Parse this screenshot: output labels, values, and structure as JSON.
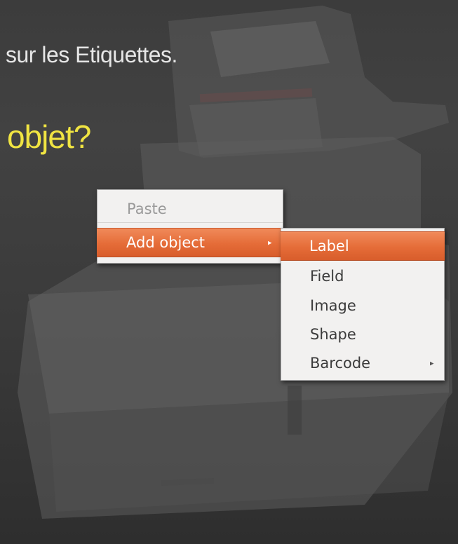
{
  "background": {
    "headline_line1": "sur les Etiquettes.",
    "headline_line2": "objet?",
    "headline_line2_color": "#f0e442"
  },
  "context_menu": {
    "items": [
      {
        "label": "Paste",
        "enabled": false
      },
      {
        "label": "Add object",
        "enabled": true,
        "highlighted": true,
        "has_submenu": true,
        "submenu_icon": "chevron-right-icon",
        "glyph": "▸"
      }
    ]
  },
  "submenu": {
    "items": [
      {
        "label": "Label",
        "highlighted": true
      },
      {
        "label": "Field"
      },
      {
        "label": "Image"
      },
      {
        "label": "Shape"
      },
      {
        "label": "Barcode",
        "has_submenu": true,
        "submenu_icon": "chevron-right-icon",
        "glyph": "▸"
      }
    ]
  },
  "colors": {
    "highlight": "#e56c38",
    "menu_bg": "#f2f1f0",
    "menu_text": "#3c3c3c",
    "disabled_text": "#9a9a9a"
  }
}
